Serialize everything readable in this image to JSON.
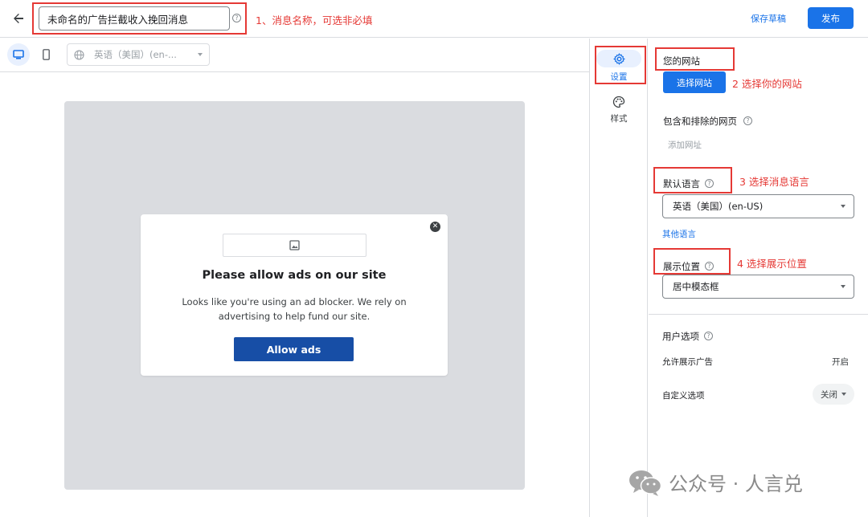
{
  "header": {
    "message_name": "未命名的广告拦截收入挽回消息",
    "save_draft_label": "保存草稿",
    "publish_label": "发布"
  },
  "annotations": {
    "a1": "1、消息名称，可选非必填",
    "a2": "2 选择你的网站",
    "a3": "3 选择消息语言",
    "a4": "4 选择展示位置"
  },
  "preview_toolbar": {
    "language_label": "英语（美国）(en-..."
  },
  "modal": {
    "title": "Please allow ads on our site",
    "description": "Looks like you're using an ad blocker. We rely on advertising to help fund our site.",
    "allow_button": "Allow ads"
  },
  "vnav": {
    "settings_label": "设置",
    "style_label": "样式"
  },
  "panel": {
    "your_site": "您的网站",
    "choose_site_button": "选择网站",
    "included_pages": "包含和排除的网页",
    "add_url": "添加网址",
    "default_language": "默认语言",
    "language_value": "英语（美国）(en-US)",
    "other_languages": "其他语言",
    "position": "展示位置",
    "position_value": "居中模态框",
    "user_options": "用户选项",
    "allow_ads_label": "允许展示广告",
    "allow_ads_state": "开启",
    "custom_option_label": "自定义选项",
    "custom_option_state": "关闭"
  },
  "watermark": {
    "text": "公众号 · 人言兑"
  },
  "colors": {
    "primary": "#1a73e8",
    "annotation_red": "#e53935",
    "allow_button": "#174ea6"
  }
}
